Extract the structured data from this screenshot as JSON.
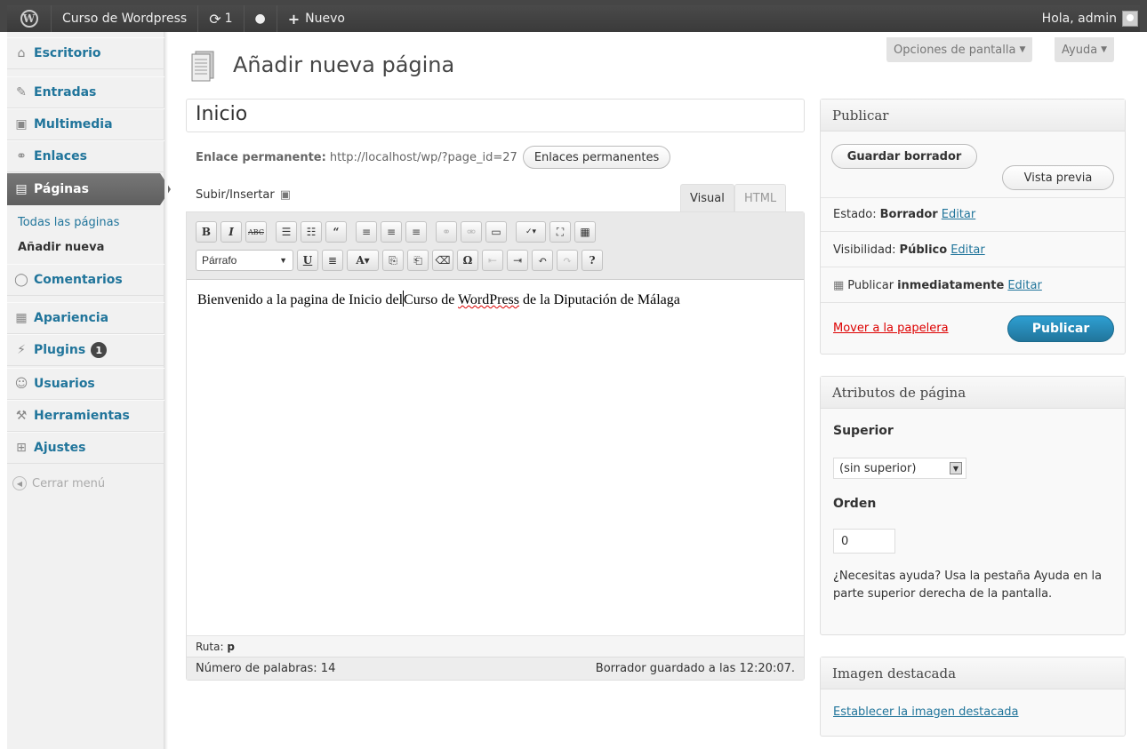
{
  "adminbar": {
    "logo": "W",
    "site_name": "Curso de Wordpress",
    "updates_icon": "refresh-icon",
    "updates_count": "1",
    "comments_icon": "comment-bubble-icon",
    "new_label": "Nuevo",
    "greeting": "Hola, admin"
  },
  "sidebar": {
    "items": [
      {
        "label": "Escritorio",
        "icon": "⌂"
      },
      {
        "label": "Entradas",
        "icon": "✎"
      },
      {
        "label": "Multimedia",
        "icon": "▣"
      },
      {
        "label": "Enlaces",
        "icon": "⚭"
      },
      {
        "label": "Páginas",
        "icon": "▤"
      },
      {
        "label": "Comentarios",
        "icon": "◯"
      },
      {
        "label": "Apariencia",
        "icon": "▦"
      },
      {
        "label": "Plugins",
        "icon": "⚡"
      },
      {
        "label": "Usuarios",
        "icon": "☺"
      },
      {
        "label": "Herramientas",
        "icon": "⚒"
      },
      {
        "label": "Ajustes",
        "icon": "⊞"
      }
    ],
    "plugins_badge": "1",
    "submenu": {
      "all_pages": "Todas las páginas",
      "add_new": "Añadir nueva"
    },
    "collapse": "Cerrar menú"
  },
  "screen_options": {
    "options": "Opciones de pantalla",
    "help": "Ayuda"
  },
  "page": {
    "title": "Añadir nueva página",
    "post_title": "Inicio",
    "permalink_label": "Enlace permanente:",
    "permalink_url": "http://localhost/wp/?page_id=27",
    "permalink_button": "Enlaces permanentes",
    "upload_label": "Subir/Insertar"
  },
  "editor": {
    "tab_visual": "Visual",
    "tab_html": "HTML",
    "format_select": "Párrafo",
    "content_before": "Bienvenido a la pagina de Inicio del",
    "content_mid": "Curso de ",
    "content_misspelled": "WordPress",
    "content_after": " de la Diputación de Málaga",
    "path_label": "Ruta:",
    "path_value": "p",
    "word_count": "Número de palabras: 14",
    "draft_saved": "Borrador guardado a las 12:20:07."
  },
  "publish": {
    "title": "Publicar",
    "save_draft": "Guardar borrador",
    "preview": "Vista previa",
    "status_label": "Estado:",
    "status_value": "Borrador",
    "visibility_label": "Visibilidad:",
    "visibility_value": "Público",
    "publish_label": "Publicar",
    "publish_value": "inmediatamente",
    "edit": "Editar",
    "trash": "Mover a la papelera",
    "publish_button": "Publicar",
    "trash_color": "#d00"
  },
  "attributes": {
    "title": "Atributos de página",
    "parent_label": "Superior",
    "parent_value": "(sin superior)",
    "order_label": "Orden",
    "order_value": "0",
    "help_text": "¿Necesitas ayuda? Usa la pestaña Ayuda en la parte superior derecha de la pantalla."
  },
  "featured": {
    "title": "Imagen destacada",
    "set_link": "Establecer la imagen destacada"
  },
  "colors": {
    "link": "#21759b",
    "adminbar": "#464646",
    "primary": "#21759b"
  }
}
